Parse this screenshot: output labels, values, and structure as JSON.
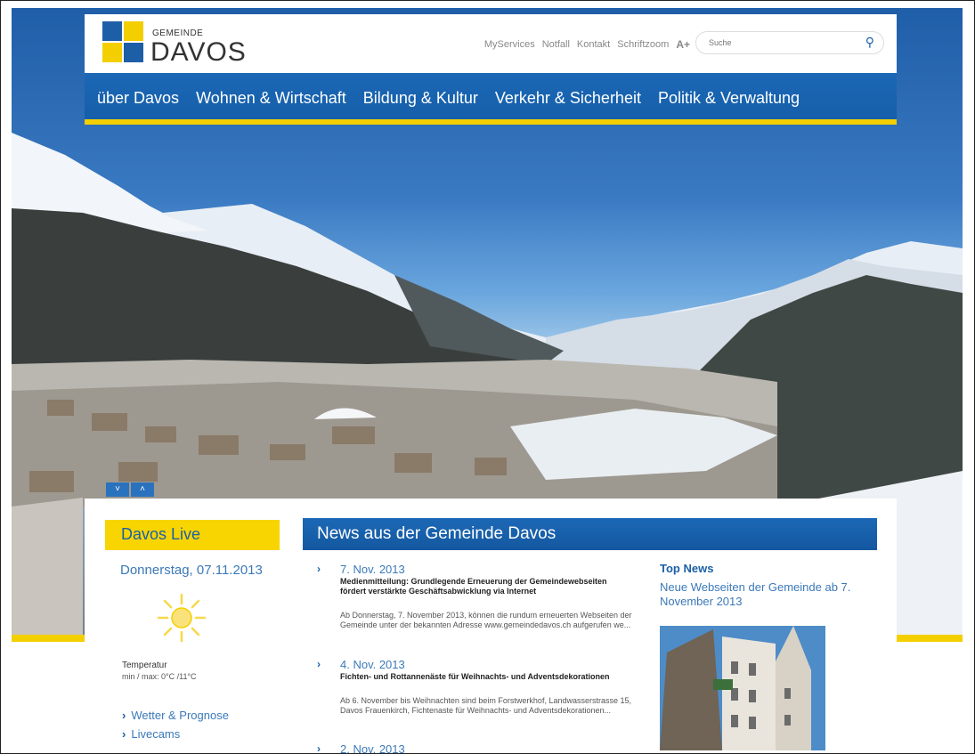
{
  "colors": {
    "brand_blue": "#1d5fa6",
    "brand_yellow": "#f4cf00",
    "link_blue": "#3b79b8"
  },
  "logo": {
    "small": "GEMEINDE",
    "big": "DAVOS"
  },
  "top_links": [
    "MyServices",
    "Notfall",
    "Kontakt",
    "Schriftzoom"
  ],
  "fontzoom_icon": "A+",
  "search": {
    "placeholder": "Suche",
    "icon": "search-icon"
  },
  "nav": [
    "über Davos",
    "Wohnen & Wirtschaft",
    "Bildung & Kultur",
    "Verkehr & Sicherheit",
    "Politik & Verwaltung"
  ],
  "slider": {
    "down": "˅",
    "up": "˄"
  },
  "live": {
    "title": "Davos Live",
    "date": "Donnerstag, 07.11.2013",
    "temp_label": "Temperatur",
    "temp_value": "min / max: 0°C /11°C",
    "links": [
      "Wetter & Prognose",
      "Livecams"
    ]
  },
  "news": {
    "title": "News aus der Gemeinde Davos",
    "items": [
      {
        "date": "7. Nov. 2013",
        "headline": "Medienmitteilung: Grundlegende Erneuerung der Gemeindewebseiten fördert verstärkte Geschäftsabwicklung via Internet",
        "teaser": "Ab Donnerstag, 7. November 2013, können die rundum erneuerten Webseiten der Gemeinde unter der bekannten Adresse www.gemeindedavos.ch aufgerufen we..."
      },
      {
        "date": "4. Nov. 2013",
        "headline": "Fichten- und Rottannenäste für Weihnachts- und Adventsdekorationen",
        "teaser": "Ab 6. November bis Weihnachten sind beim Forstwerkhof, Landwasserstrasse 15, Davos Frauenkirch, Fichtenaste für Weihnachts- und Adventsdekorationen..."
      },
      {
        "date": "2. Nov. 2013"
      }
    ]
  },
  "topnews": {
    "label": "Top News",
    "headline": "Neue Webseiten der Gemeinde ab 7. November 2013"
  }
}
